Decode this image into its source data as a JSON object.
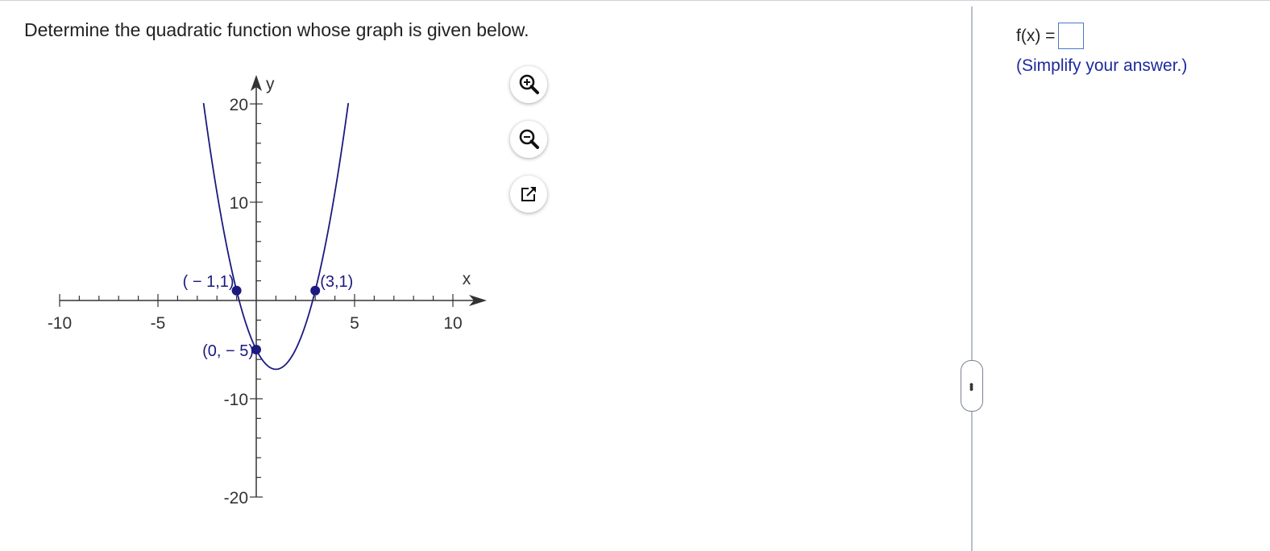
{
  "question": "Determine the quadratic function whose graph is given below.",
  "answer": {
    "label": "f(x) =",
    "value": "",
    "hint": "(Simplify your answer.)"
  },
  "tools": {
    "zoom_in_icon": "zoom-in-icon",
    "zoom_out_icon": "zoom-out-icon",
    "popout_icon": "popout-icon"
  },
  "colors": {
    "curve": "#1a1a80",
    "accent": "#1c2a9e",
    "input_border": "#4a78c9"
  },
  "chart_data": {
    "type": "line",
    "function": "y = 2x^2 - 4x - 5",
    "xlim": [
      -10,
      10
    ],
    "ylim": [
      -20,
      20
    ],
    "xlabel": "x",
    "ylabel": "y",
    "x_ticks": [
      "-10",
      "-5",
      "5",
      "10"
    ],
    "y_ticks": [
      "20",
      "10",
      "-10",
      "-20"
    ],
    "curve_domain": [
      -2.7,
      4.7
    ],
    "points": [
      {
        "x": -1,
        "y": 1,
        "label": "( − 1,1)"
      },
      {
        "x": 0,
        "y": -5,
        "label": "(0, − 5)"
      },
      {
        "x": 3,
        "y": 1,
        "label": "(3,1)"
      }
    ],
    "grid": false
  }
}
